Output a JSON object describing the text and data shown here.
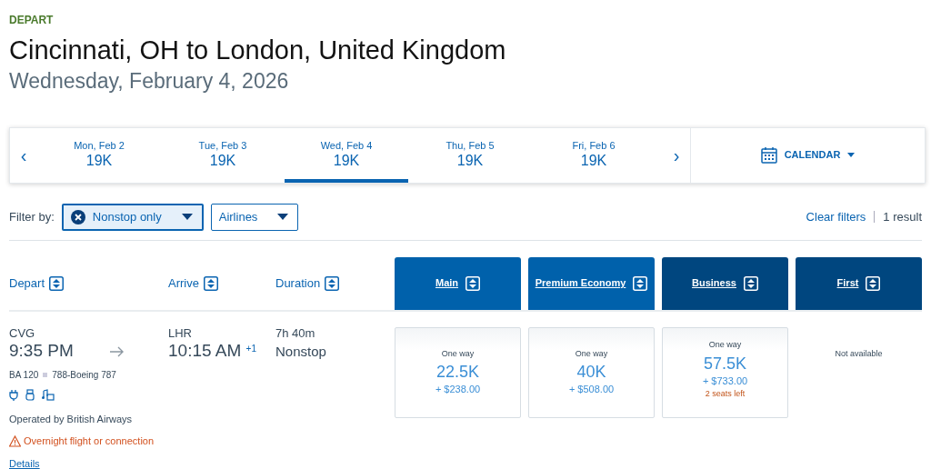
{
  "section_label": "DEPART",
  "title": "Cincinnati, OH to London, United Kingdom",
  "subtitle": "Wednesday, February 4, 2026",
  "date_strip": {
    "prev": "‹",
    "next": "›",
    "calendar": "CALENDAR",
    "dates": [
      {
        "label": "Mon, Feb 2",
        "price": "19K",
        "selected": false
      },
      {
        "label": "Tue, Feb 3",
        "price": "19K",
        "selected": false
      },
      {
        "label": "Wed, Feb 4",
        "price": "19K",
        "selected": true
      },
      {
        "label": "Thu, Feb 5",
        "price": "19K",
        "selected": false
      },
      {
        "label": "Fri, Feb 6",
        "price": "19K",
        "selected": false
      }
    ]
  },
  "filters": {
    "label": "Filter by:",
    "chips": [
      {
        "label": "Nonstop only",
        "selected": true
      },
      {
        "label": "Airlines",
        "selected": false
      }
    ],
    "clear": "Clear filters",
    "result_count": "1 result"
  },
  "columns": [
    "Depart",
    "Arrive",
    "Duration"
  ],
  "cabins": [
    {
      "name": "Main",
      "color": "#0061ab"
    },
    {
      "name": "Premium Economy",
      "color": "#0061ab"
    },
    {
      "name": "Business",
      "color": "#00467f"
    },
    {
      "name": "First",
      "color": "#00467f"
    }
  ],
  "flight": {
    "origin": "CVG",
    "depart_time": "9:35 PM",
    "destination": "LHR",
    "arrive_time": "10:15 AM",
    "day_offset": "+1",
    "duration": "7h 40m",
    "stops": "Nonstop",
    "flight_number": "BA 120",
    "aircraft": "788-Boeing 787",
    "operator": "Operated by British Airways",
    "warning": "Overnight flight or connection",
    "details": "Details",
    "fares": [
      {
        "kind": "fare",
        "type": "One way",
        "miles": "22.5K",
        "cash": "+ $238.00"
      },
      {
        "kind": "fare",
        "type": "One way",
        "miles": "40K",
        "cash": "+ $508.00"
      },
      {
        "kind": "fare",
        "type": "One way",
        "miles": "57.5K",
        "cash": "+ $733.00",
        "note": "2 seats left"
      },
      {
        "kind": "unavailable",
        "text": "Not available"
      }
    ]
  }
}
